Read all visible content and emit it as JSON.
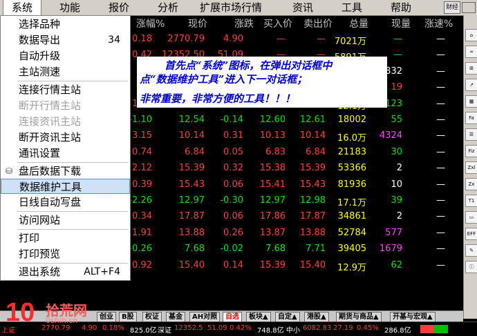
{
  "menubar": {
    "items": [
      "系统",
      "功能",
      "报价",
      "分析",
      "扩展市场行情",
      "资讯",
      "工具",
      "帮助"
    ],
    "logo": "财经"
  },
  "table": {
    "headers": [
      "涨幅%",
      "现价",
      "涨跌",
      "买入价",
      "卖出价",
      "总量",
      "现量",
      "涨速%"
    ],
    "rows": [
      [
        "0.18",
        "2770.79",
        "4.90",
        "—",
        "—",
        "7021万",
        "—",
        "—"
      ],
      [
        "0.42",
        "12352.50",
        "51.09",
        "—",
        "—",
        "5891万",
        "—",
        "—"
      ],
      [
        "",
        "",
        "",
        "",
        "",
        "",
        "6832",
        "—"
      ],
      [
        "",
        "",
        "",
        "",
        "",
        "",
        "19",
        "—"
      ],
      [
        "1.63",
        "6.24",
        "0.10",
        "6.24",
        "6.25",
        "12.1万",
        "123",
        "—"
      ],
      [
        "-1.10",
        "12.54",
        "-0.14",
        "12.60",
        "12.61",
        "18002",
        "55",
        "—"
      ],
      [
        "3.15",
        "10.14",
        "0.31",
        "10.13",
        "10.14",
        "16.0万",
        "4324",
        "—"
      ],
      [
        "0.74",
        "6.84",
        "0.05",
        "6.83",
        "6.84",
        "21183",
        "30",
        "—"
      ],
      [
        "2.12",
        "15.39",
        "0.32",
        "15.38",
        "15.39",
        "53366",
        "2",
        "—"
      ],
      [
        "0.39",
        "15.43",
        "0.06",
        "15.41",
        "15.43",
        "81936",
        "10",
        "—"
      ],
      [
        "-2.26",
        "12.97",
        "-0.30",
        "12.97",
        "12.98",
        "17.1万",
        "39",
        "—"
      ],
      [
        "0.34",
        "17.87",
        "0.06",
        "17.86",
        "17.87",
        "34861",
        "2",
        "—"
      ],
      [
        "1.91",
        "13.88",
        "0.26",
        "13.87",
        "13.88",
        "52784",
        "577",
        "—"
      ],
      [
        "-0.26",
        "7.68",
        "-0.02",
        "7.68",
        "7.71",
        "39405",
        "1679",
        "—"
      ],
      [
        "0.92",
        "15.40",
        "0.14",
        "15.39",
        "15.40",
        "12.9万",
        "62",
        "—"
      ]
    ]
  },
  "dropdown": {
    "items": [
      {
        "label": "选择品种",
        "shortcut": "",
        "disabled": false
      },
      {
        "label": "数据导出",
        "shortcut": "34",
        "disabled": false
      },
      {
        "label": "自动升级",
        "shortcut": "",
        "disabled": false
      },
      {
        "label": "主站测速",
        "shortcut": "",
        "disabled": false
      },
      {
        "label": "连接行情主站",
        "shortcut": "",
        "disabled": false
      },
      {
        "label": "断开行情主站",
        "shortcut": "",
        "disabled": true
      },
      {
        "label": "连接资讯主站",
        "shortcut": "",
        "disabled": true
      },
      {
        "label": "断开资讯主站",
        "shortcut": "",
        "disabled": false
      },
      {
        "label": "通讯设置",
        "shortcut": "",
        "disabled": false
      },
      {
        "label": "盘后数据下载",
        "shortcut": "",
        "disabled": false
      },
      {
        "label": "数据维护工具",
        "shortcut": "",
        "disabled": false
      },
      {
        "label": "日线自动写盘",
        "shortcut": "",
        "disabled": false
      },
      {
        "label": "访问网站",
        "shortcut": "",
        "disabled": false
      },
      {
        "label": "打印",
        "shortcut": "",
        "disabled": false
      },
      {
        "label": "打印预览",
        "shortcut": "",
        "disabled": false
      },
      {
        "label": "退出系统",
        "shortcut": "ALT+F4",
        "disabled": false
      }
    ]
  },
  "annotation": {
    "line1": "首先点“系统”图标，在弹出对话框中",
    "line2": "点“数据维护工具”进入下一对话框；",
    "line3": "非常重要，非常方便的工具！！！"
  },
  "tabs": [
    "创业",
    "B股",
    "权证",
    "基金",
    "AH对照",
    "自选",
    "板块▲",
    "自定▲",
    "港股▲",
    "期货与商品▲",
    "开基与宏观▲"
  ],
  "statusbar": {
    "s1": "上证",
    "s1v": "2770.79",
    "s1c": "4.90",
    "s1p": "0.18%",
    "s1a": "825.0亿",
    "s2": "深证",
    "s2v": "12352.5",
    "s2c": "51.09",
    "s2p": "0.42%",
    "s2a": "748.8亿",
    "s3": "中小",
    "s3v": "6082.83",
    "s3c": "27.19",
    "s3p": "0.45%",
    "s3a": "286.8亿"
  },
  "watermark": {
    "num": "10",
    "cn": "拾荒网",
    "url": "0shih.cn"
  },
  "toolbar_icons": [
    "Fa",
    "Fiz",
    "Zxl",
    "Zx",
    "T1",
    "EFF"
  ]
}
